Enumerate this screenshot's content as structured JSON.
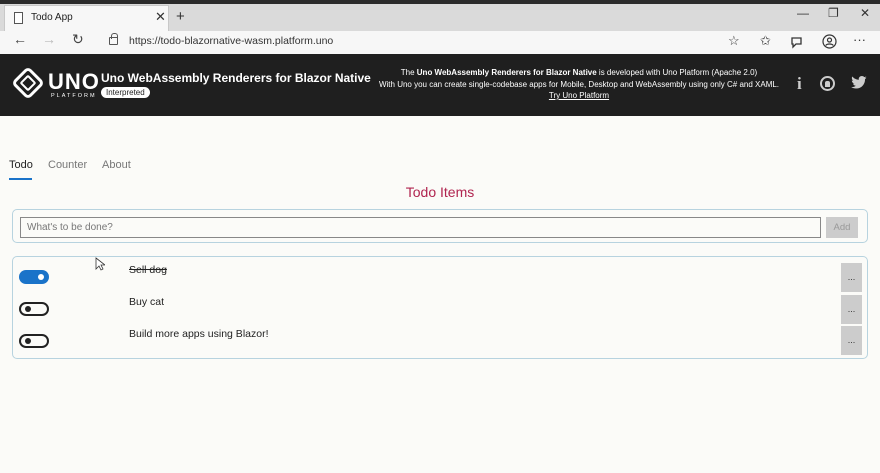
{
  "browser": {
    "tab_title": "Todo App",
    "tab_close": "✕",
    "new_tab": "+",
    "win_minimize": "—",
    "win_maximize": "❐",
    "win_close": "✕",
    "back": "←",
    "forward": "→",
    "refresh": "↻",
    "url": "https://todo-blazornative-wasm.platform.uno",
    "favorite": "☆",
    "favorites_hub": "✩",
    "more": "···"
  },
  "header": {
    "logo_word": "UNO",
    "logo_sub": "PLATFORM",
    "title": "Uno WebAssembly Renderers for Blazor Native",
    "badge": "Interpreted",
    "info_prefix": "The ",
    "info_bold": "Uno WebAssembly Renderers for Blazor Native",
    "info_suffix": " is developed with Uno Platform (Apache 2.0)",
    "info_line2": "With Uno you can create single-codebase apps for Mobile, Desktop and WebAssembly using only C# and XAML.",
    "info_link": "Try Uno Platform",
    "info_icon": "i"
  },
  "nav": {
    "tabs": [
      {
        "label": "Todo",
        "active": true
      },
      {
        "label": "Counter",
        "active": false
      },
      {
        "label": "About",
        "active": false
      }
    ]
  },
  "main": {
    "title": "Todo Items",
    "new_todo": {
      "placeholder": "What's to be done?",
      "value": "",
      "add_label": "Add"
    },
    "todos": [
      {
        "text": "Sell dog",
        "done": true,
        "more": "..."
      },
      {
        "text": "Buy cat",
        "done": false,
        "more": "..."
      },
      {
        "text": "Build more apps using Blazor!",
        "done": false,
        "more": "..."
      }
    ]
  },
  "colors": {
    "accent": "#1a73c9",
    "title": "#b0244f",
    "header_bg": "#1f1f1f"
  }
}
